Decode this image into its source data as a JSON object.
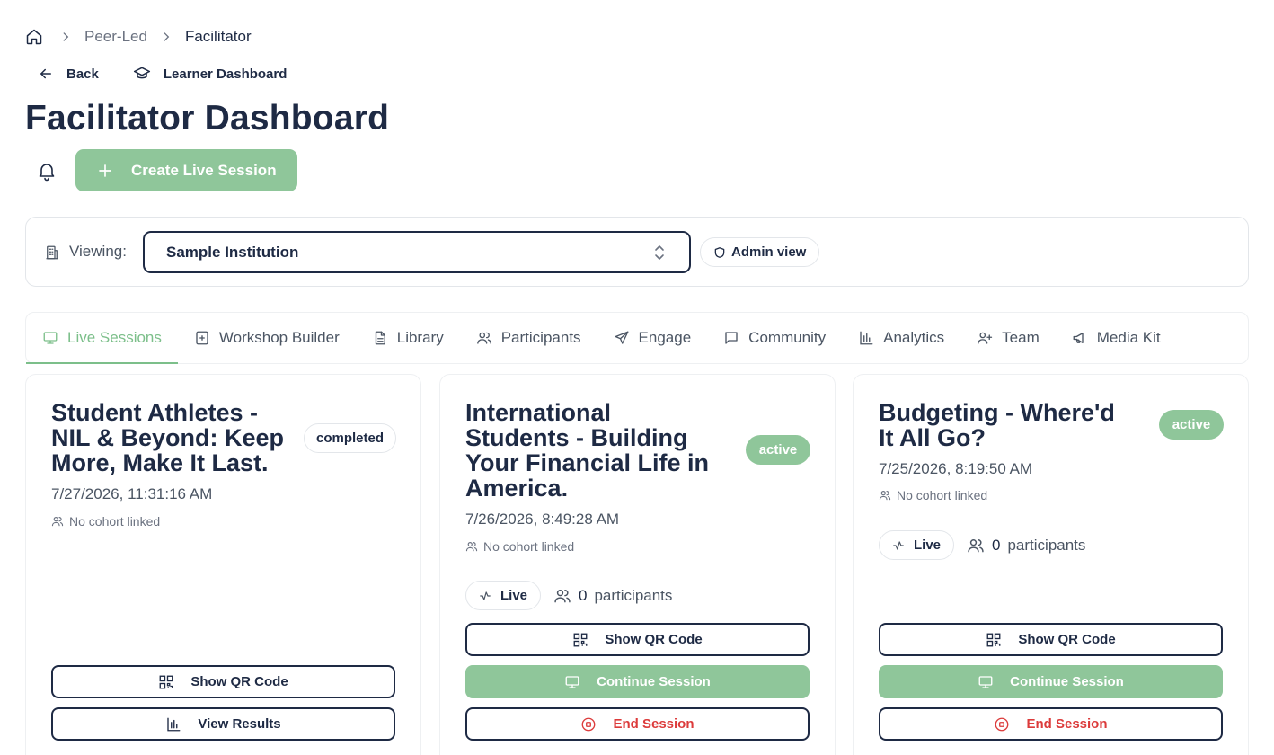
{
  "breadcrumb": {
    "home_icon": "home-icon",
    "items": [
      "Peer-Led",
      "Facilitator"
    ]
  },
  "nav": {
    "back": "Back",
    "learner_dashboard": "Learner Dashboard"
  },
  "page_title": "Facilitator Dashboard",
  "toolbar": {
    "create_session": "Create Live Session"
  },
  "viewing": {
    "label": "Viewing:",
    "selected_institution": "Sample Institution",
    "admin_view": "Admin view"
  },
  "tabs": [
    {
      "label": "Live Sessions",
      "icon": "monitor-icon",
      "active": true
    },
    {
      "label": "Workshop Builder",
      "icon": "square-plus-icon"
    },
    {
      "label": "Library",
      "icon": "file-icon"
    },
    {
      "label": "Participants",
      "icon": "users-icon"
    },
    {
      "label": "Engage",
      "icon": "send-icon"
    },
    {
      "label": "Community",
      "icon": "chat-icon"
    },
    {
      "label": "Analytics",
      "icon": "bar-chart-icon"
    },
    {
      "label": "Team",
      "icon": "user-plus-icon"
    },
    {
      "label": "Media Kit",
      "icon": "megaphone-icon"
    }
  ],
  "sessions": [
    {
      "title_lines": [
        "Student Athletes -",
        "NIL & Beyond: Keep",
        "More, Make It Last."
      ],
      "status": "completed",
      "date": "7/27/2026, 11:31:16 AM",
      "cohort": "No cohort linked",
      "buttons": {
        "qr": "Show QR Code",
        "results": "View Results"
      }
    },
    {
      "title_lines": [
        "International",
        "Students - Building",
        "Your Financial Life in",
        "America."
      ],
      "status": "active",
      "date": "7/26/2026, 8:49:28 AM",
      "cohort": "No cohort linked",
      "live_label": "Live",
      "participants_count": "0",
      "participants_label": "participants",
      "buttons": {
        "qr": "Show QR Code",
        "continue": "Continue Session",
        "end": "End Session"
      }
    },
    {
      "title_lines": [
        "Budgeting - Where'd",
        "It All Go?"
      ],
      "status": "active",
      "date": "7/25/2026, 8:19:50 AM",
      "cohort": "No cohort linked",
      "live_label": "Live",
      "participants_count": "0",
      "participants_label": "participants",
      "buttons": {
        "qr": "Show QR Code",
        "continue": "Continue Session",
        "end": "End Session"
      }
    }
  ],
  "colors": {
    "accent_green": "#8fc69a",
    "tab_active": "#7cbf8a",
    "navy": "#1e2a44",
    "danger": "#dc3b3b"
  }
}
